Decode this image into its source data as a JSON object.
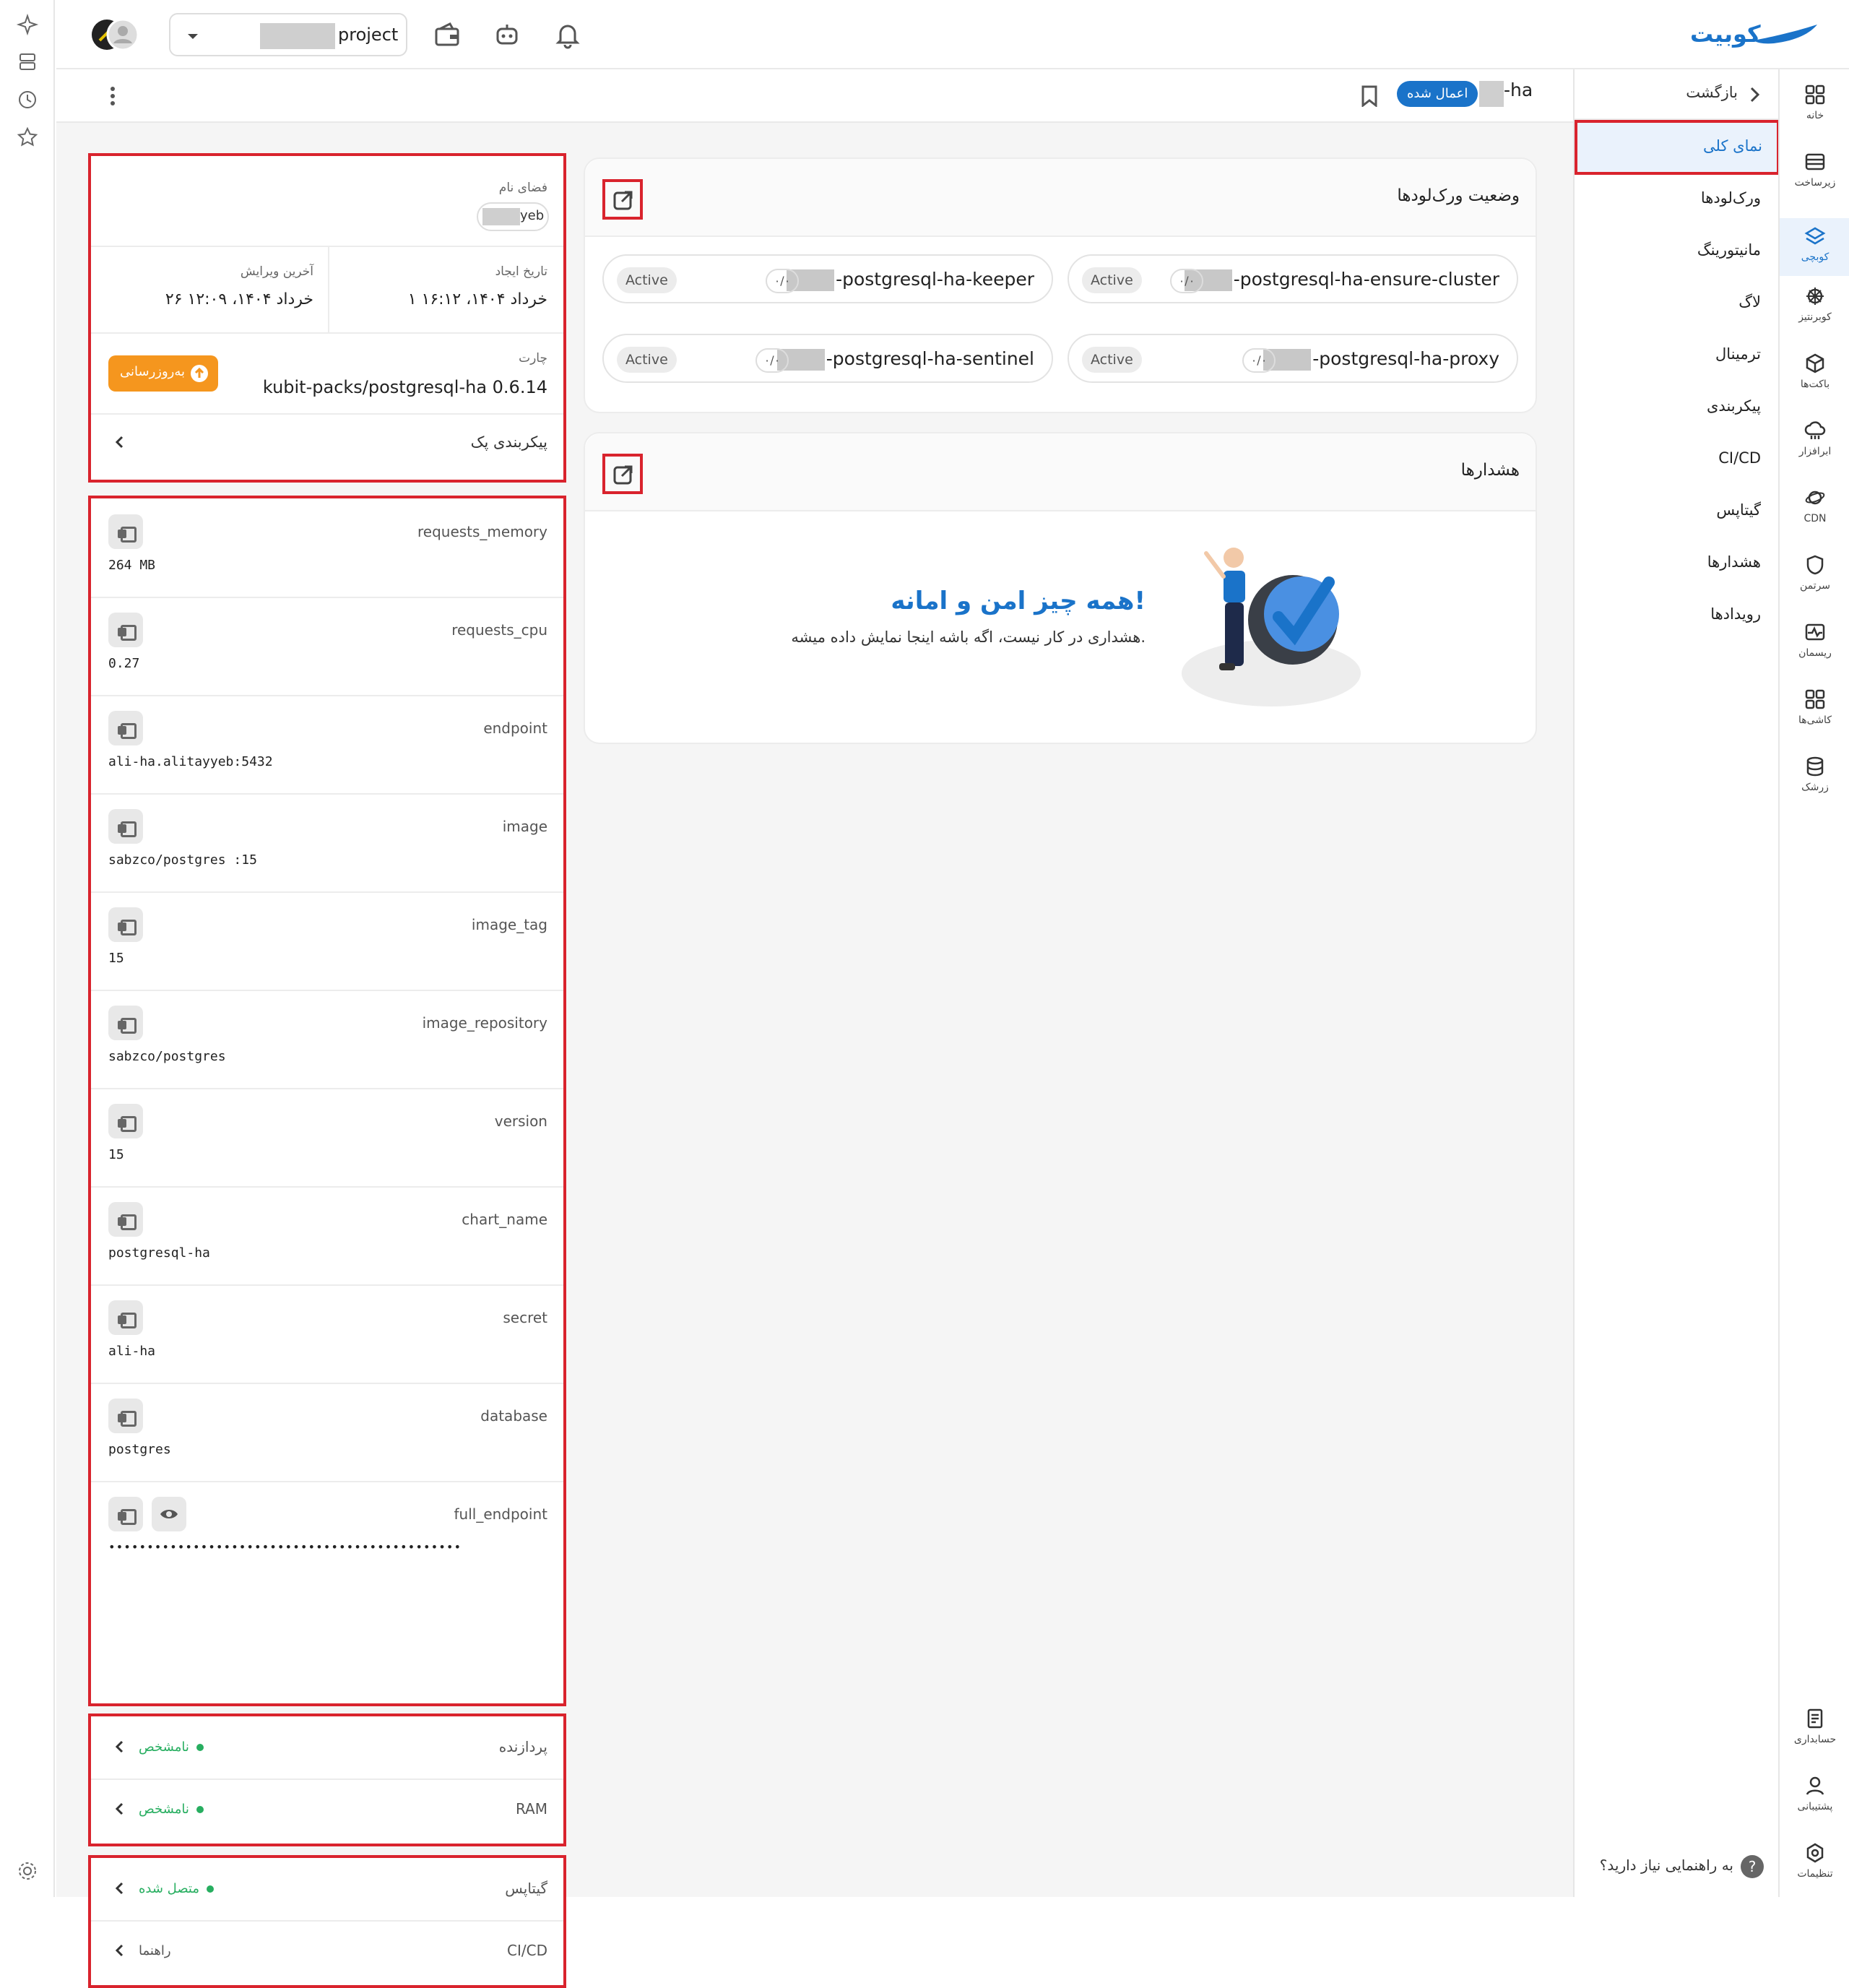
{
  "brand": {
    "logo_text": "کوبیت",
    "color": "#1a73c9"
  },
  "topbar": {
    "project_label": "project",
    "icons": [
      "wallet-icon",
      "robot-icon",
      "bell-icon"
    ]
  },
  "subbar": {
    "back_label": "بازگشت",
    "app_name": "-ha",
    "applied_badge": "اعمال شده"
  },
  "rightnav": {
    "items": [
      {
        "label": "نمای کلی",
        "active": true
      },
      {
        "label": "ورک‌لودها"
      },
      {
        "label": "مانیتورینگ"
      },
      {
        "label": "لاگ"
      },
      {
        "label": "ترمینال"
      },
      {
        "label": "پیکربندی"
      },
      {
        "label": "CI/CD"
      },
      {
        "label": "گیتاپس"
      },
      {
        "label": "هشدارها"
      },
      {
        "label": "رویدادها"
      }
    ],
    "help_text": "به راهنمایی نیاز دارید؟"
  },
  "rail": {
    "items": [
      {
        "label": "خانه"
      },
      {
        "label": "زیرساخت"
      },
      {
        "label": "کوبچی"
      },
      {
        "label": "کوبرنتیز"
      },
      {
        "label": "باکت‌ها"
      },
      {
        "label": "ابرافزار"
      },
      {
        "label": "CDN"
      },
      {
        "label": "سرتمن"
      },
      {
        "label": "ریسمان"
      },
      {
        "label": "کاشی‌ها"
      },
      {
        "label": "زرشک"
      }
    ],
    "bottom": [
      {
        "label": "حسابداری"
      },
      {
        "label": "پشتیبانی"
      },
      {
        "label": "تنظیمات"
      }
    ]
  },
  "workloads": {
    "title": "وضعیت ورک‌لودها",
    "items": [
      {
        "name": "-postgresql-ha-ensure-cluster",
        "ratio": "۰/۰",
        "status": "Active"
      },
      {
        "name": "-postgresql-ha-keeper",
        "ratio": "۰/۰",
        "status": "Active"
      },
      {
        "name": "-postgresql-ha-proxy",
        "ratio": "۰/۰",
        "status": "Active"
      },
      {
        "name": "-postgresql-ha-sentinel",
        "ratio": "۰/۰",
        "status": "Active"
      }
    ]
  },
  "alerts": {
    "title": "هشدارها",
    "heading": "همه چیز امن و امانه!",
    "sub": "هشداری در کار نیست، اگه باشه اینجا نمایش داده میشه."
  },
  "info": {
    "namespace_label": "فضای نام",
    "namespace_value": "yeb",
    "created_label": "تاریخ ایجاد",
    "created_value": "۱ خرداد ۱۴۰۴، ۱۶:۱۲",
    "edited_label": "آخرین ویرایش",
    "edited_value": "۲۶ خرداد ۱۴۰۴، ۱۲:۰۹",
    "chart_label": "چارت",
    "chart_value": "kubit-packs/postgresql-ha 0.6.14",
    "update_button": "به‌روزرسانی",
    "pack_config_label": "پیکربندی پک"
  },
  "env_vars": [
    {
      "key": "requests_memory",
      "value": "264 MB"
    },
    {
      "key": "requests_cpu",
      "value": "0.27"
    },
    {
      "key": "endpoint",
      "value": "ali-ha.alitayyeb:5432"
    },
    {
      "key": "image",
      "value": "sabzco/postgres :15"
    },
    {
      "key": "image_tag",
      "value": "15"
    },
    {
      "key": "image_repository",
      "value": "sabzco/postgres"
    },
    {
      "key": "version",
      "value": "15"
    },
    {
      "key": "chart_name",
      "value": "postgresql-ha"
    },
    {
      "key": "secret",
      "value": "ali-ha"
    },
    {
      "key": "database",
      "value": "postgres"
    },
    {
      "key": "full_endpoint",
      "value": "••••••••••••••••••••••••••••••••••••••••••••••"
    }
  ],
  "resources": [
    {
      "label": "پردازنده",
      "status": "نامشخص"
    },
    {
      "label": "RAM",
      "status": "نامشخص"
    }
  ],
  "integrations": [
    {
      "label": "گیتاپس",
      "status": "متصل شده"
    },
    {
      "label": "CI/CD",
      "status": "راهنما"
    }
  ]
}
